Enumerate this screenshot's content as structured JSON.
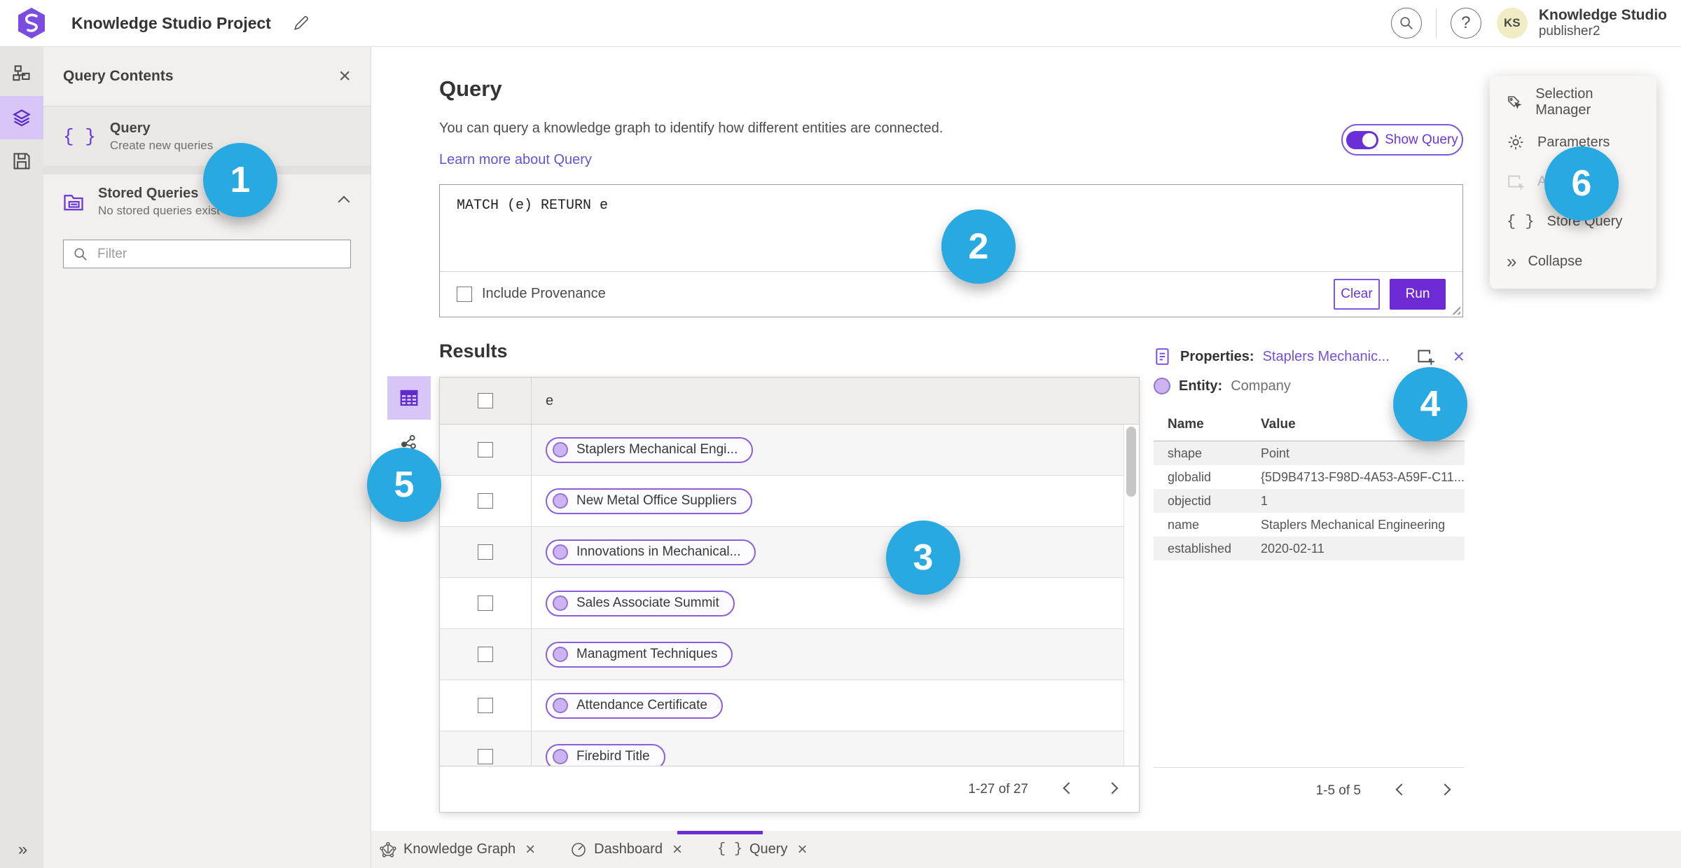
{
  "topbar": {
    "title": "Knowledge Studio Project",
    "avatar_initials": "KS",
    "user_name": "Knowledge Studio",
    "user_sub": "publisher2"
  },
  "left_panel": {
    "title": "Query Contents",
    "items": [
      {
        "title": "Query",
        "subtitle": "Create new queries"
      },
      {
        "title": "Stored Queries",
        "subtitle": "No stored queries exist"
      }
    ],
    "filter_placeholder": "Filter"
  },
  "query_section": {
    "title": "Query",
    "description": "You can query a knowledge graph to identify how different entities are connected.",
    "learn_more": "Learn more about Query",
    "show_query_label": "Show Query",
    "query_text": "MATCH (e) RETURN e",
    "include_provenance_label": "Include Provenance",
    "clear_label": "Clear",
    "run_label": "Run"
  },
  "results": {
    "title": "Results",
    "column_header": "e",
    "rows": [
      "Staplers Mechanical Engi...",
      "New Metal Office Suppliers",
      "Innovations in Mechanical...",
      "Sales Associate Summit",
      "Managment Techniques",
      "Attendance Certificate",
      "Firebird Title"
    ],
    "pagination": "1-27 of 27"
  },
  "properties_panel": {
    "title_prefix": "Properties:",
    "title_link": "Staplers Mechanic...",
    "entity_label": "Entity:",
    "entity_value": "Company",
    "columns": {
      "name": "Name",
      "value": "Value"
    },
    "rows": [
      {
        "name": "shape",
        "value": "Point"
      },
      {
        "name": "globalid",
        "value": "{5D9B4713-F98D-4A53-A59F-C11..."
      },
      {
        "name": "objectid",
        "value": "1"
      },
      {
        "name": "name",
        "value": "Staplers Mechanical Engineering"
      },
      {
        "name": "established",
        "value": "2020-02-11"
      }
    ],
    "pagination": "1-5 of 5"
  },
  "side_menu": {
    "items": [
      {
        "label": "Selection Manager"
      },
      {
        "label": "Parameters"
      },
      {
        "label": "Ad",
        "disabled": true
      },
      {
        "label": "Store Query"
      },
      {
        "label": "Collapse"
      }
    ]
  },
  "tabs": [
    {
      "label": "Knowledge Graph"
    },
    {
      "label": "Dashboard"
    },
    {
      "label": "Query",
      "active": true
    }
  ],
  "annotations": [
    {
      "n": "1"
    },
    {
      "n": "2"
    },
    {
      "n": "3"
    },
    {
      "n": "4"
    },
    {
      "n": "5"
    },
    {
      "n": "6"
    }
  ],
  "icons": [
    "app-logo",
    "edit-pencil",
    "search",
    "help",
    "org-chart",
    "layers",
    "save",
    "braces",
    "folder-box",
    "magnifier",
    "table-view",
    "link-chart",
    "properties-doc",
    "add-to-selection",
    "close",
    "selection-manager-tag",
    "gear",
    "collapse-chevrons",
    "knowledge-graph",
    "dashboard-gauge",
    "chevron-left",
    "chevron-right",
    "chevron-up"
  ],
  "colors": {
    "accent_purple": "#6e2bd5",
    "light_purple": "#d9c6f8",
    "annotation_blue": "#29a9e2",
    "link_purple": "#6a52d6",
    "avatar_yellow": "#f0ecc4"
  }
}
